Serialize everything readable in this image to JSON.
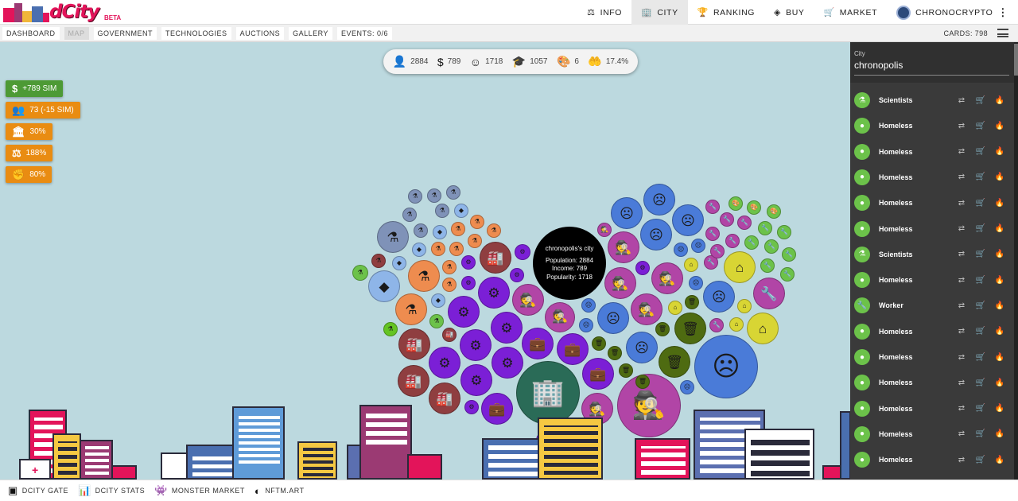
{
  "brand": {
    "name": "dCity",
    "tag": "BETA"
  },
  "topnav": [
    {
      "label": "INFO",
      "icon": "⚖",
      "active": false
    },
    {
      "label": "CITY",
      "icon": "🏢",
      "active": true
    },
    {
      "label": "RANKING",
      "icon": "🏆",
      "active": false
    },
    {
      "label": "BUY",
      "icon": "◈",
      "active": false
    },
    {
      "label": "MARKET",
      "icon": "🛒",
      "active": false
    }
  ],
  "user": {
    "name": "CHRONOCRYPTO"
  },
  "subnav": [
    {
      "label": "DASHBOARD",
      "active": false
    },
    {
      "label": "MAP",
      "active": true
    },
    {
      "label": "GOVERNMENT",
      "active": false
    },
    {
      "label": "TECHNOLOGIES",
      "active": false
    },
    {
      "label": "AUCTIONS",
      "active": false
    },
    {
      "label": "GALLERY",
      "active": false
    },
    {
      "label": "EVENTS: 0/6",
      "active": false
    }
  ],
  "cards_count": "CARDS: 798",
  "stats": [
    {
      "icon": "👤",
      "value": "2884"
    },
    {
      "icon": "$",
      "value": "789"
    },
    {
      "icon": "☺",
      "value": "1718"
    },
    {
      "icon": "🎓",
      "value": "1057"
    },
    {
      "icon": "🎨",
      "value": "6"
    },
    {
      "icon": "🤲",
      "value": "17.4%"
    }
  ],
  "badges": [
    {
      "icon": "$",
      "label": "+789 SIM",
      "color": "#4d9a35"
    },
    {
      "icon": "👥",
      "label": "73 (-15 SIM)",
      "color": "#e98c12"
    },
    {
      "icon": "🏛",
      "label": "30%",
      "color": "#e98c12"
    },
    {
      "icon": "⚖",
      "label": "188%",
      "color": "#e98c12"
    },
    {
      "icon": "✊",
      "label": "80%",
      "color": "#e98c12"
    }
  ],
  "city_info": {
    "title": "chronopolis's city",
    "population": "Population: 2884",
    "income": "Income: 789",
    "popularity": "Popularity: 1718"
  },
  "panel": {
    "label": "City",
    "city": "chronopolis",
    "cards": [
      {
        "name": "Scientists",
        "icon": "⚗"
      },
      {
        "name": "Homeless",
        "icon": "●"
      },
      {
        "name": "Homeless",
        "icon": "●"
      },
      {
        "name": "Homeless",
        "icon": "●"
      },
      {
        "name": "Homeless",
        "icon": "●"
      },
      {
        "name": "Homeless",
        "icon": "●"
      },
      {
        "name": "Scientists",
        "icon": "⚗"
      },
      {
        "name": "Homeless",
        "icon": "●"
      },
      {
        "name": "Worker",
        "icon": "🔧"
      },
      {
        "name": "Homeless",
        "icon": "●"
      },
      {
        "name": "Homeless",
        "icon": "●"
      },
      {
        "name": "Homeless",
        "icon": "●"
      },
      {
        "name": "Homeless",
        "icon": "●"
      },
      {
        "name": "Homeless",
        "icon": "●"
      },
      {
        "name": "Homeless",
        "icon": "●"
      }
    ],
    "actions": [
      "⇄",
      "🛒",
      "🔥"
    ]
  },
  "footer": [
    {
      "icon": "▣",
      "label": "DCITY GATE"
    },
    {
      "icon": "📊",
      "label": "DCITY STATS"
    },
    {
      "icon": "👾",
      "label": "MONSTER MARKET"
    },
    {
      "icon": "◐",
      "label": "NFTM.ART"
    }
  ],
  "colors": {
    "blue": "#4a7bd8",
    "purple": "#7b1fd6",
    "orange": "#ee8c4f",
    "magenta": "#b145a6",
    "darkred": "#8f3e40",
    "green": "#6cc24a",
    "olive": "#4e6b11",
    "yellow": "#d8d534",
    "teal": "#2a6b57",
    "lightblue": "#8eb5e8",
    "slate": "#7f92b8",
    "lime": "#64c423"
  },
  "bubble_glyphs": {
    "sad": "☹",
    "flask": "⚗",
    "cube": "◆",
    "factory": "🏭",
    "gear": "⚙",
    "briefcase": "💼",
    "spy": "🕵",
    "house": "⌂",
    "trash": "🗑",
    "wrench": "🔧",
    "palette": "🎨",
    "building": "🏢",
    "dot": "●"
  }
}
